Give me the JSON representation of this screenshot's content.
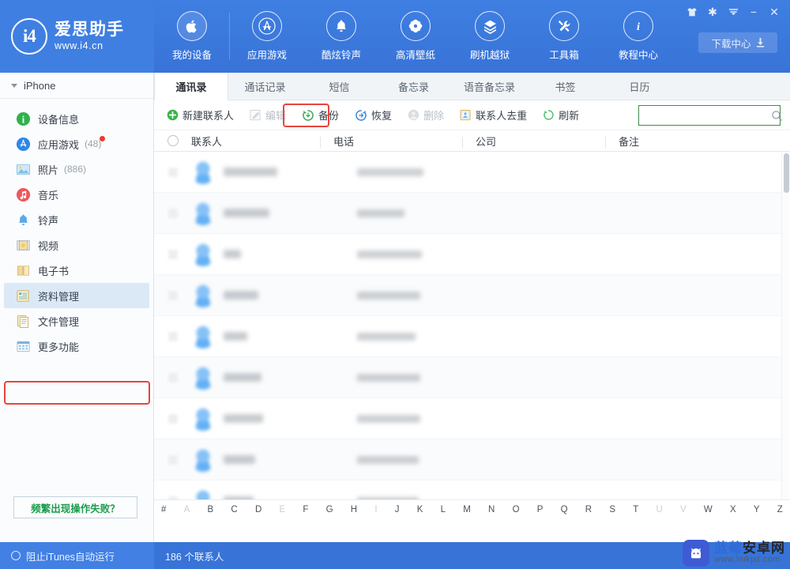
{
  "brand": {
    "logo_text": "i4",
    "title": "爱思助手",
    "url": "www.i4.cn"
  },
  "topnav": {
    "items": [
      {
        "label": "我的设备",
        "icon": "apple-icon",
        "active": true
      },
      {
        "label": "应用游戏",
        "icon": "appstore-icon",
        "active": false
      },
      {
        "label": "酷炫铃声",
        "icon": "bell-icon",
        "active": false
      },
      {
        "label": "高清壁纸",
        "icon": "flower-icon",
        "active": false
      },
      {
        "label": "刷机越狱",
        "icon": "box-icon",
        "active": false
      },
      {
        "label": "工具箱",
        "icon": "tools-icon",
        "active": false
      },
      {
        "label": "教程中心",
        "icon": "info-icon",
        "active": false
      }
    ],
    "window_controls": [
      "skin-icon",
      "settings-icon",
      "menu-icon",
      "minimize-icon",
      "close-icon"
    ],
    "download_center": "下载中心"
  },
  "sidebar": {
    "device": "iPhone",
    "items": [
      {
        "label": "设备信息",
        "count": "",
        "icon": "info-circle-icon",
        "selected": false
      },
      {
        "label": "应用游戏",
        "count": "(48)",
        "icon": "appstore-circle-icon",
        "selected": false,
        "dot": true
      },
      {
        "label": "照片",
        "count": "(886)",
        "icon": "photo-icon",
        "selected": false
      },
      {
        "label": "音乐",
        "count": "",
        "icon": "music-icon",
        "selected": false
      },
      {
        "label": "铃声",
        "count": "",
        "icon": "ringtone-icon",
        "selected": false
      },
      {
        "label": "视频",
        "count": "",
        "icon": "video-icon",
        "selected": false
      },
      {
        "label": "电子书",
        "count": "",
        "icon": "book-icon",
        "selected": false
      },
      {
        "label": "资料管理",
        "count": "",
        "icon": "data-icon",
        "selected": true
      },
      {
        "label": "文件管理",
        "count": "",
        "icon": "file-icon",
        "selected": false
      },
      {
        "label": "更多功能",
        "count": "",
        "icon": "more-icon",
        "selected": false
      }
    ],
    "help_button": "频繁出现操作失败？"
  },
  "tabs": [
    {
      "label": "通讯录",
      "active": true
    },
    {
      "label": "通话记录",
      "active": false
    },
    {
      "label": "短信",
      "active": false
    },
    {
      "label": "备忘录",
      "active": false
    },
    {
      "label": "语音备忘录",
      "active": false
    },
    {
      "label": "书签",
      "active": false
    },
    {
      "label": "日历",
      "active": false
    }
  ],
  "toolbar": {
    "buttons": [
      {
        "label": "新建联系人",
        "icon": "plus-circle-icon",
        "disabled": false
      },
      {
        "label": "编辑",
        "icon": "edit-icon",
        "disabled": true
      },
      {
        "label": "备份",
        "icon": "backup-icon",
        "disabled": false,
        "highlighted": true
      },
      {
        "label": "恢复",
        "icon": "restore-icon",
        "disabled": false
      },
      {
        "label": "删除",
        "icon": "delete-icon",
        "disabled": true
      },
      {
        "label": "联系人去重",
        "icon": "dedupe-icon",
        "disabled": false
      },
      {
        "label": "刷新",
        "icon": "refresh-icon",
        "disabled": false
      }
    ]
  },
  "search": {
    "value": "",
    "placeholder": "",
    "icon": "search-icon"
  },
  "table": {
    "columns": [
      "联系人",
      "电话",
      "公司",
      "备注"
    ],
    "row_count": 9
  },
  "alphabar": {
    "letters": [
      {
        "ch": "#",
        "dim": false
      },
      {
        "ch": "A",
        "dim": true
      },
      {
        "ch": "B",
        "dim": false
      },
      {
        "ch": "C",
        "dim": false
      },
      {
        "ch": "D",
        "dim": false
      },
      {
        "ch": "E",
        "dim": true
      },
      {
        "ch": "F",
        "dim": false
      },
      {
        "ch": "G",
        "dim": false
      },
      {
        "ch": "H",
        "dim": false
      },
      {
        "ch": "I",
        "dim": true
      },
      {
        "ch": "J",
        "dim": false
      },
      {
        "ch": "K",
        "dim": false
      },
      {
        "ch": "L",
        "dim": false
      },
      {
        "ch": "M",
        "dim": false
      },
      {
        "ch": "N",
        "dim": false
      },
      {
        "ch": "O",
        "dim": false
      },
      {
        "ch": "P",
        "dim": false
      },
      {
        "ch": "Q",
        "dim": false
      },
      {
        "ch": "R",
        "dim": false
      },
      {
        "ch": "S",
        "dim": false
      },
      {
        "ch": "T",
        "dim": false
      },
      {
        "ch": "U",
        "dim": true
      },
      {
        "ch": "V",
        "dim": true
      },
      {
        "ch": "W",
        "dim": false
      },
      {
        "ch": "X",
        "dim": false
      },
      {
        "ch": "Y",
        "dim": false
      },
      {
        "ch": "Z",
        "dim": false
      }
    ]
  },
  "statusbar": {
    "itunes_toggle": "阻止iTunes自动运行",
    "contact_count": "186 个联系人"
  },
  "watermark": {
    "name_1": "蓝莓",
    "name_2": "安卓网",
    "url": "www.lmkjst.com"
  },
  "colors": {
    "brand_blue": "#3873d8",
    "highlight_red": "#e8453c",
    "search_border": "#3e8c4b",
    "selected_sidebar": "#dbe9f7",
    "help_green": "#1a9c4d"
  }
}
